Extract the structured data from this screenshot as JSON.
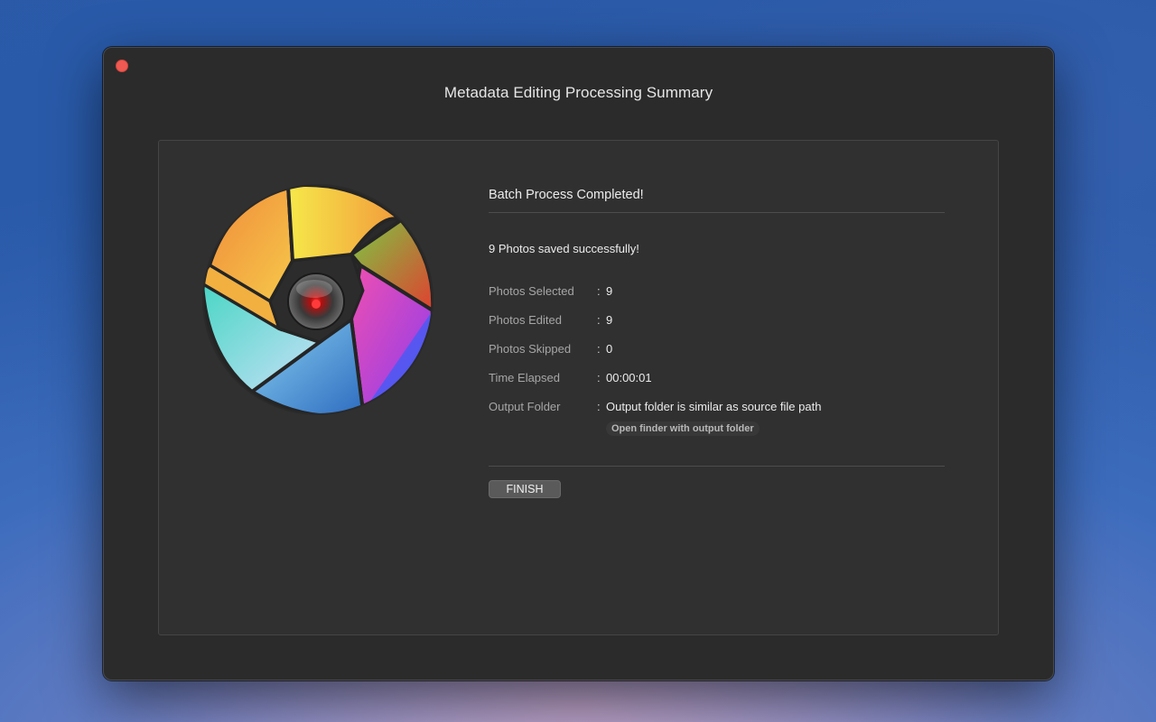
{
  "window": {
    "title": "Metadata Editing Processing Summary"
  },
  "summary": {
    "heading": "Batch Process Completed!",
    "success_message": "9 Photos saved successfully!",
    "rows": [
      {
        "label": "Photos Selected",
        "colon": ":",
        "value": "9"
      },
      {
        "label": "Photos Edited",
        "colon": ":",
        "value": "9"
      },
      {
        "label": "Photos Skipped",
        "colon": ":",
        "value": "0"
      },
      {
        "label": "Time Elapsed",
        "colon": ":",
        "value": "00:00:01"
      },
      {
        "label": "Output Folder",
        "colon": ":",
        "value": "Output folder is similar as source file path"
      }
    ],
    "open_finder_label": "Open finder with output folder",
    "finish_label": "FINISH"
  },
  "icons": {
    "close": "close-icon",
    "logo": "aperture-logo-icon"
  },
  "colors": {
    "close": "#ee5a52",
    "window_bg": "#2b2b2b",
    "panel_bg": "#303030"
  }
}
